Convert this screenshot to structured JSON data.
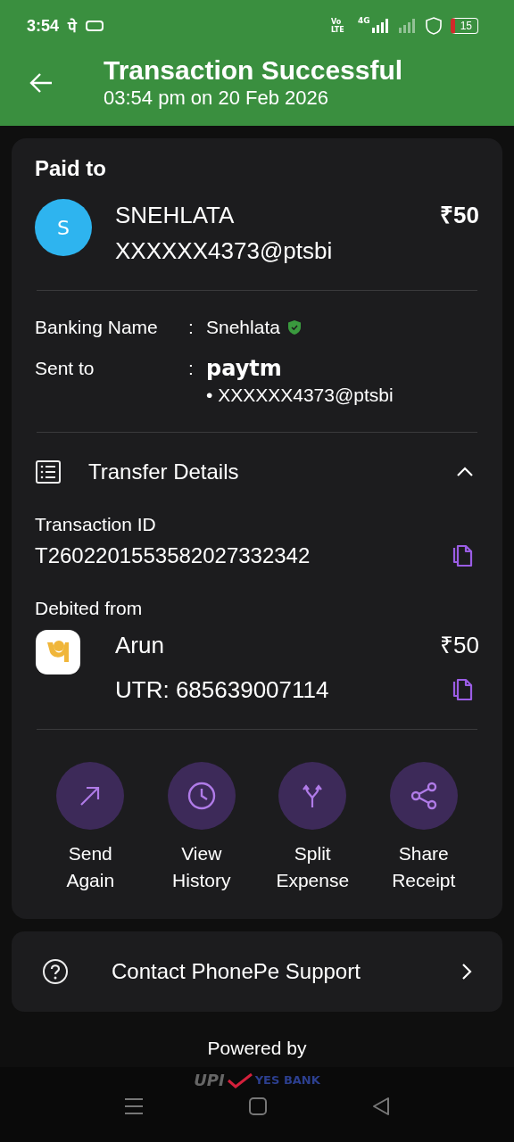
{
  "status_bar": {
    "time": "3:54",
    "app_badge": "पे",
    "volte": "Vo LTE",
    "network": "4G",
    "battery": "15"
  },
  "header": {
    "title": "Transaction Successful",
    "subtitle": "03:54 pm on 20 Feb 2026"
  },
  "paid_to": {
    "heading": "Paid to",
    "avatar_letter": "S",
    "name": "SNEHLATA",
    "amount": "₹50",
    "upi_id": "XXXXXX4373@ptsbi",
    "details": [
      {
        "label": "Banking Name",
        "separator": ":",
        "value": "Snehlata",
        "verified": true
      },
      {
        "label": "Sent to",
        "separator": ":",
        "provider": "paytm",
        "value": "• XXXXXX4373@ptsbi",
        "verified": false
      }
    ]
  },
  "transfer_details": {
    "title": "Transfer Details",
    "expanded": true,
    "transaction_id_label": "Transaction ID",
    "transaction_id": "T2602201553582027332342",
    "debited_label": "Debited from",
    "account_name": "Arun",
    "amount": "₹50",
    "utr": "UTR: 685639007114"
  },
  "actions": [
    {
      "kind": "send",
      "label": "Send Again"
    },
    {
      "kind": "history",
      "label": "View History"
    },
    {
      "kind": "split",
      "label": "Split Expense"
    },
    {
      "kind": "share",
      "label": "Share Receipt"
    }
  ],
  "support": {
    "label": "Contact PhonePe Support"
  },
  "footer": {
    "powered_by": "Powered by",
    "upi": "UPI",
    "bank": "YES BANK"
  }
}
